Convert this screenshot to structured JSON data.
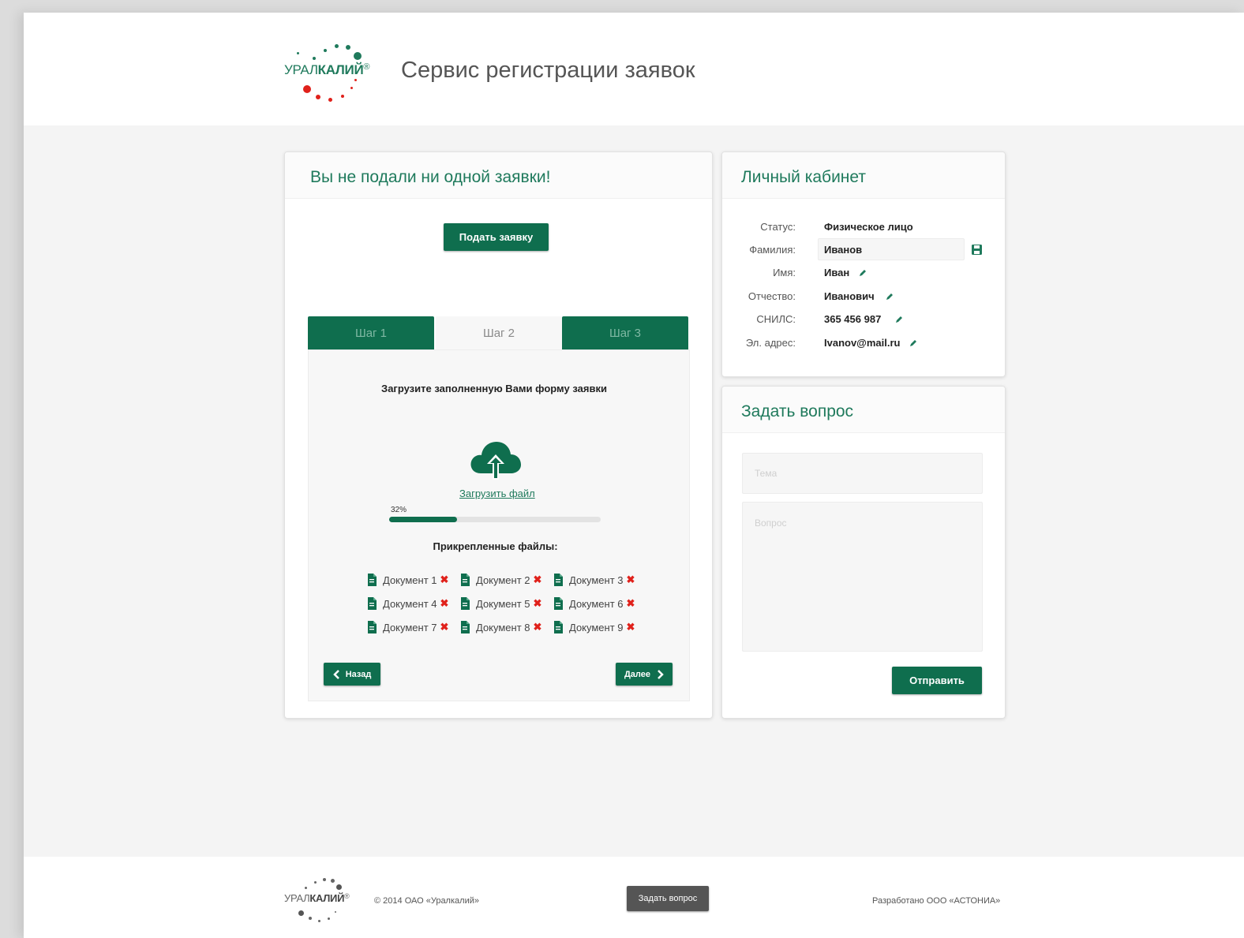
{
  "brand": {
    "logo_prefix": "УРАЛ",
    "logo_name": "КАЛИЙ",
    "logo_mark": "®",
    "colors": {
      "green": "#0f6e4e",
      "title_green": "#1f7a5c",
      "red": "#e0211b"
    }
  },
  "header": {
    "title": "Сервис регистрации заявок"
  },
  "applications": {
    "title": "Вы не подали ни одной заявки!",
    "submit_label": "Подать заявку",
    "tabs": [
      {
        "label": "Шаг 1",
        "active": false
      },
      {
        "label": "Шаг 2",
        "active": true
      },
      {
        "label": "Шаг 3",
        "active": false
      }
    ],
    "step": {
      "instruction": "Загрузите заполненную Вами форму заявки",
      "upload_icon": "cloud-upload-icon",
      "upload_link": "Загрузить файл",
      "progress_label": "32%",
      "progress": 0.32,
      "attached_title": "Прикрепленные файлы:",
      "files": [
        "Документ 1",
        "Документ 2",
        "Документ 3",
        "Документ 4",
        "Документ 5",
        "Документ 6",
        "Документ 7",
        "Документ 8",
        "Документ 9"
      ],
      "remove_icon": "remove-x-icon",
      "file_icon": "file-icon",
      "back_label": "Назад",
      "next_label": "Далее"
    }
  },
  "profile": {
    "title": "Личный кабинет",
    "fields": [
      {
        "label": "Статус:",
        "value": "Физическое лицо"
      },
      {
        "label": "Фамилия:",
        "value": "Иванов"
      },
      {
        "label": "Имя:",
        "value": "Иван"
      },
      {
        "label": "Отчество:",
        "value": "Иванович"
      },
      {
        "label": "СНИЛС:",
        "value": "365 456 987"
      },
      {
        "label": "Эл. адрес:",
        "value": "Ivanov@mail.ru"
      }
    ],
    "save_icon": "save-icon",
    "edit_icon": "pencil-icon"
  },
  "question": {
    "title": "Задать вопрос",
    "topic_placeholder": "Тема",
    "question_placeholder": "Вопрос",
    "send_label": "Отправить"
  },
  "footer": {
    "copyright": "© 2014 ОАО «Уралкалий»",
    "ask_label": "Задать вопрос",
    "developer": "Разработано ООО «АСТОНИА»"
  }
}
